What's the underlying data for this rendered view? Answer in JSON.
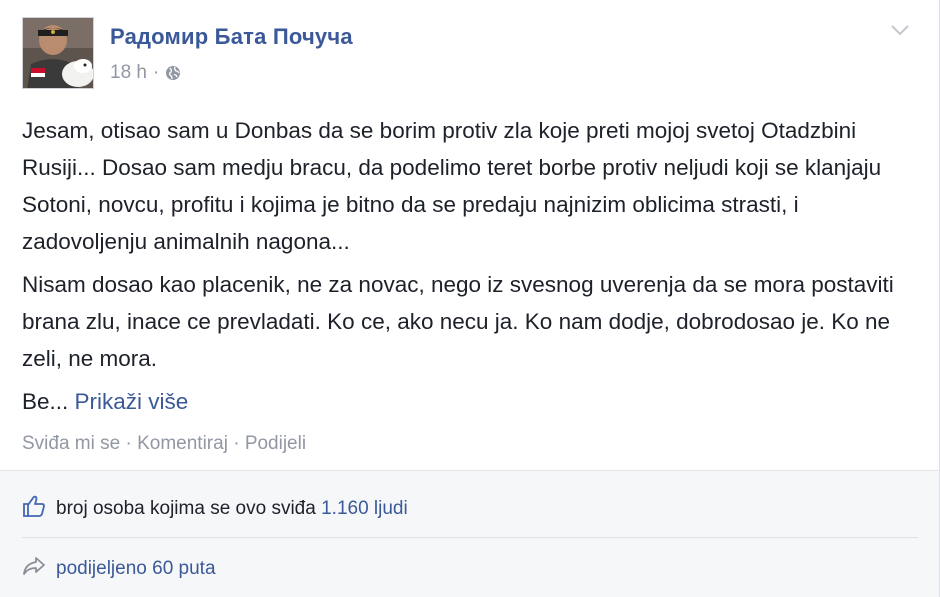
{
  "post": {
    "author_name": "Радомир Бата Почуча",
    "time": "18 h",
    "meta_sep": "·",
    "privacy_icon": "globe-icon",
    "options_icon": "chevron-down-icon",
    "paragraphs": [
      "Jesam, otisao sam u Donbas da se borim protiv zla koje preti mojoj svetoj Otadzbini Rusiji... Dosao sam medju bracu, da podelimo teret borbe protiv neljudi koji se klanjaju Sotoni, novcu, profitu i kojima je bitno da se predaju najnizim oblicima strasti, i zadovoljenju animalnih nagona...",
      "Nisam dosao kao placenik, ne za novac, nego iz svesnog uverenja da se mora postaviti brana zlu, inace ce prevladati. Ko ce, ako necu ja. Ko nam dodje, dobrodosao je. Ko ne zeli, ne mora."
    ],
    "truncated_text": "Be...",
    "see_more": "Prikaži više"
  },
  "actions": {
    "like": "Sviđa mi se",
    "comment": "Komentiraj",
    "share": "Podijeli",
    "sep": " · "
  },
  "footer": {
    "likes_icon": "thumbs-up-icon",
    "likes_text": "broj osoba kojima se ovo sviđa",
    "likes_count": "1.160 ljudi",
    "shares_icon": "share-arrow-icon",
    "shares_text": "podijeljeno 60 puta"
  },
  "colors": {
    "link": "#3b5998",
    "text": "#1d2129",
    "meta": "#9197a3",
    "footer_bg": "#f6f7f9"
  }
}
